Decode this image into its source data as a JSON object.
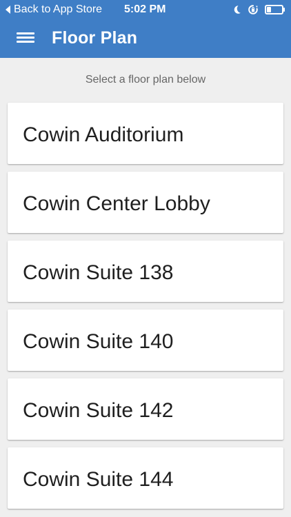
{
  "status_bar": {
    "back_label": "Back to App Store",
    "time": "5:02 PM",
    "icons": [
      "moon-icon",
      "rotation-lock-icon",
      "battery-icon"
    ]
  },
  "app_bar": {
    "title": "Floor Plan",
    "menu_icon": "menu-icon"
  },
  "subtitle": "Select a floor plan below",
  "floor_plans": [
    {
      "label": "Cowin Auditorium"
    },
    {
      "label": "Cowin Center Lobby"
    },
    {
      "label": "Cowin Suite 138"
    },
    {
      "label": "Cowin Suite 140"
    },
    {
      "label": "Cowin Suite 142"
    },
    {
      "label": "Cowin Suite 144"
    }
  ],
  "colors": {
    "primary": "#3f7ec6",
    "background": "#efefef",
    "card": "#ffffff",
    "text": "#1f1f1f",
    "subtle_text": "#666666"
  }
}
